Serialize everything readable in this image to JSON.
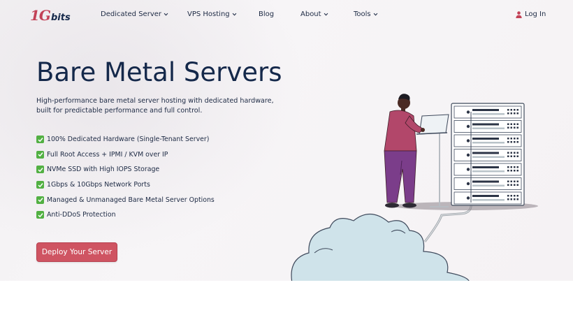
{
  "brand": {
    "logo_number": "1G",
    "logo_word": "bits",
    "primary_color": "#c24156",
    "navy": "#15284a"
  },
  "nav": {
    "items": [
      {
        "label": "Dedicated Server",
        "has_dropdown": true
      },
      {
        "label": "VPS Hosting",
        "has_dropdown": true
      },
      {
        "label": "Blog",
        "has_dropdown": false
      },
      {
        "label": "About",
        "has_dropdown": true
      },
      {
        "label": "Tools",
        "has_dropdown": true
      }
    ],
    "login_label": "Log In",
    "login_icon": "user-icon"
  },
  "hero": {
    "title": "Bare Metal Servers",
    "description": "High-performance bare metal server hosting with dedicated hardware, built for predictable performance and full control.",
    "features": [
      "100% Dedicated Hardware (Single-Tenant Server)",
      "Full Root Access + IPMI / KVM over IP",
      "NVMe SSD with High IOPS Storage",
      "1Gbps & 10Gbps Network Ports",
      "Managed & Unmanaged Bare Metal Server Options",
      "Anti-DDoS Protection"
    ],
    "feature_icon": "check-mark-icon",
    "feature_icon_color": "#52b043",
    "cta_label": "Deploy Your Server",
    "cta_color": "#cf5462"
  }
}
